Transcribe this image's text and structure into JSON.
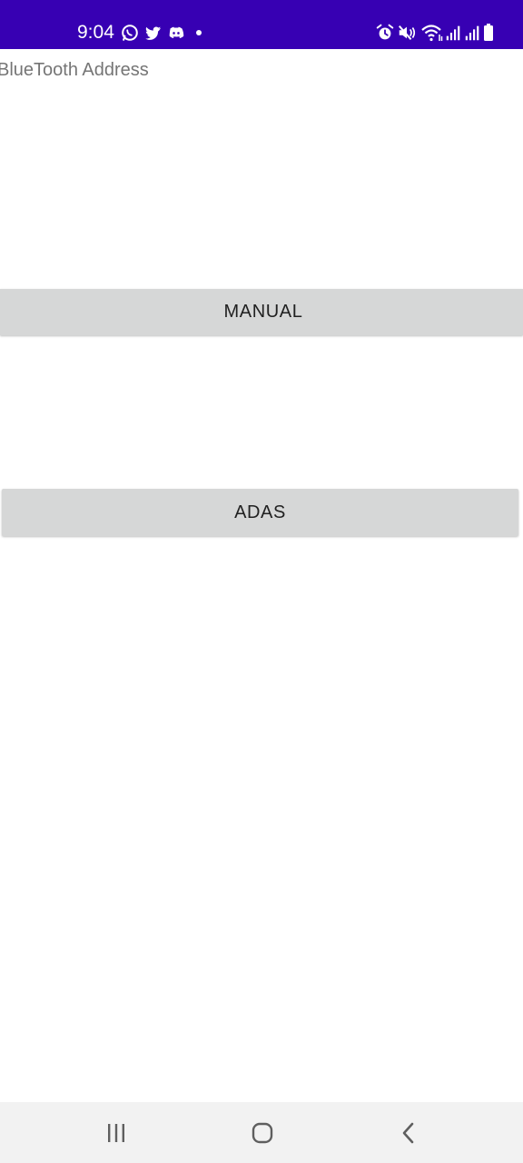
{
  "status_bar": {
    "time": "9:04",
    "background": "#3700b3",
    "left_icons": [
      "whatsapp-icon",
      "twitter-icon",
      "discord-icon",
      "notification-dot-icon"
    ],
    "right_icons": [
      "alarm-icon",
      "mute-icon",
      "wifi-icon",
      "signal-icon",
      "signal-icon",
      "battery-icon"
    ]
  },
  "main": {
    "address_label": "BlueTooth Address",
    "manual_button": "MANUAL",
    "adas_button": "ADAS",
    "button_color": "#d6d7d7"
  },
  "nav_bar": {
    "icons": [
      "recent-apps-icon",
      "home-icon",
      "back-icon"
    ]
  }
}
